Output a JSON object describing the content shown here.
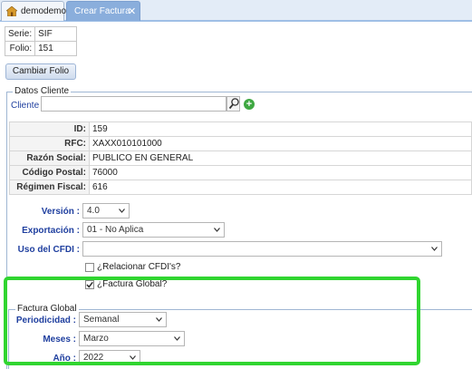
{
  "tabs": [
    {
      "label": "demodemo"
    },
    {
      "label": "Crear Factura",
      "close": "✕"
    }
  ],
  "serie": {
    "serie_label": "Serie:",
    "serie_value": "SIF",
    "folio_label": "Folio:",
    "folio_value": "151"
  },
  "buttons": {
    "cambiar_folio": "Cambiar Folio"
  },
  "datos_cliente": {
    "legend": "Datos Cliente",
    "cliente_label": "Cliente :",
    "cliente_value": "",
    "add_symbol": "+",
    "rows": [
      {
        "label": "ID:",
        "value": "159"
      },
      {
        "label": "RFC:",
        "value": "XAXX010101000"
      },
      {
        "label": "Razón Social:",
        "value": "PUBLICO EN GENERAL"
      },
      {
        "label": "Código Postal:",
        "value": "76000"
      },
      {
        "label": "Régimen Fiscal:",
        "value": "616"
      }
    ]
  },
  "form": {
    "version_label": "Versión :",
    "version_value": "4.0",
    "exportacion_label": "Exportación :",
    "exportacion_value": "01 - No Aplica",
    "uso_label": "Uso del CFDI :",
    "uso_value": "",
    "relacionar_label": "¿Relacionar CFDI's?",
    "relacionar_checked": false,
    "factura_global_label": "¿Factura Global?",
    "factura_global_checked": true
  },
  "factura_global": {
    "legend": "Factura Global",
    "periodicidad_label": "Periodicidad :",
    "periodicidad_value": "Semanal",
    "meses_label": "Meses :",
    "meses_value": "Marzo",
    "anio_label": "Año :",
    "anio_value": "2022"
  },
  "colors": {
    "highlight": "#30d530",
    "tab_active": "#8aaedc",
    "label_blue": "#1f3f9f"
  }
}
